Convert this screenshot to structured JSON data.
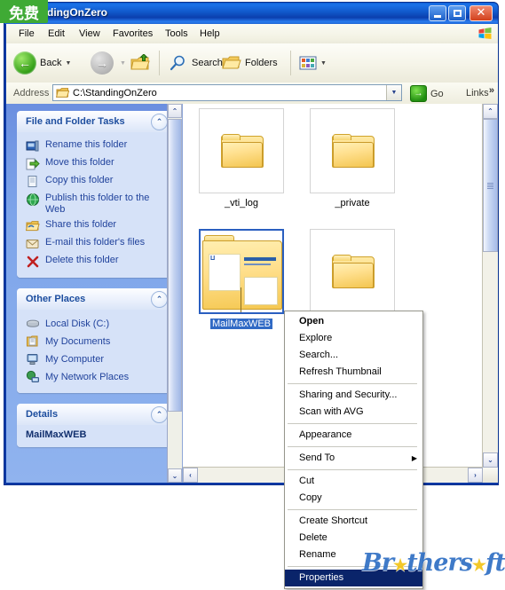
{
  "window": {
    "title": "StandingOnZero",
    "badge": "免费",
    "controls": {
      "minimize": "Minimize",
      "maximize": "Maximize",
      "close": "Close"
    }
  },
  "menubar": {
    "items": [
      {
        "label": "File"
      },
      {
        "label": "Edit"
      },
      {
        "label": "View"
      },
      {
        "label": "Favorites"
      },
      {
        "label": "Tools"
      },
      {
        "label": "Help"
      }
    ],
    "logo": "windows-flag-icon"
  },
  "toolbar": {
    "back": "Back",
    "forward": "Forward",
    "up": "Up",
    "search": "Search",
    "folders": "Folders",
    "views": "Views"
  },
  "address": {
    "label": "Address",
    "value": "C:\\StandingOnZero",
    "go": "Go",
    "links": "Links",
    "chevron": "»"
  },
  "sidebar": {
    "panels": [
      {
        "title": "File and Folder Tasks",
        "collapse": "collapse-chevron-icon",
        "items": [
          {
            "label": "Rename this folder",
            "icon": "rename-icon"
          },
          {
            "label": "Move this folder",
            "icon": "move-icon"
          },
          {
            "label": "Copy this folder",
            "icon": "copy-icon"
          },
          {
            "label": "Publish this folder to the Web",
            "icon": "publish-web-icon"
          },
          {
            "label": "Share this folder",
            "icon": "share-folder-icon"
          },
          {
            "label": "E-mail this folder's files",
            "icon": "email-icon"
          },
          {
            "label": "Delete this folder",
            "icon": "delete-x-icon"
          }
        ]
      },
      {
        "title": "Other Places",
        "collapse": "collapse-chevron-icon",
        "items": [
          {
            "label": "Local Disk (C:)",
            "icon": "hard-disk-icon"
          },
          {
            "label": "My Documents",
            "icon": "my-documents-icon"
          },
          {
            "label": "My Computer",
            "icon": "my-computer-icon"
          },
          {
            "label": "My Network Places",
            "icon": "network-places-icon"
          }
        ]
      },
      {
        "title": "Details",
        "collapse": "collapse-chevron-icon",
        "selected_name": "MailMaxWEB"
      }
    ]
  },
  "files": {
    "view": "thumbnails",
    "items": [
      {
        "name": "_vti_log",
        "type": "folder",
        "selected": false
      },
      {
        "name": "_private",
        "type": "folder",
        "selected": false
      },
      {
        "name": "MailMaxWEB",
        "type": "folder-thumbnail",
        "selected": true
      },
      {
        "name": "",
        "type": "folder",
        "selected": false
      }
    ]
  },
  "context_menu": {
    "groups": [
      [
        {
          "label": "Open",
          "bold": true,
          "highlighted": false,
          "submenu": false
        },
        {
          "label": "Explore",
          "bold": false,
          "highlighted": false,
          "submenu": false
        },
        {
          "label": "Search...",
          "bold": false,
          "highlighted": false,
          "submenu": false
        },
        {
          "label": "Refresh Thumbnail",
          "bold": false,
          "highlighted": false,
          "submenu": false
        }
      ],
      [
        {
          "label": "Sharing and Security...",
          "bold": false,
          "highlighted": false,
          "submenu": false
        },
        {
          "label": "Scan with AVG",
          "bold": false,
          "highlighted": false,
          "submenu": false
        }
      ],
      [
        {
          "label": "Appearance",
          "bold": false,
          "highlighted": false,
          "submenu": false
        }
      ],
      [
        {
          "label": "Send To",
          "bold": false,
          "highlighted": false,
          "submenu": true
        }
      ],
      [
        {
          "label": "Cut",
          "bold": false,
          "highlighted": false,
          "submenu": false
        },
        {
          "label": "Copy",
          "bold": false,
          "highlighted": false,
          "submenu": false
        }
      ],
      [
        {
          "label": "Create Shortcut",
          "bold": false,
          "highlighted": false,
          "submenu": false
        },
        {
          "label": "Delete",
          "bold": false,
          "highlighted": false,
          "submenu": false
        },
        {
          "label": "Rename",
          "bold": false,
          "highlighted": false,
          "submenu": false
        }
      ],
      [
        {
          "label": "Properties",
          "bold": false,
          "highlighted": true,
          "submenu": false
        }
      ]
    ]
  },
  "watermark": {
    "part1": "Br",
    "star": "★",
    "part2": "thers",
    "star2": "★",
    "part3": "ft"
  },
  "colors": {
    "titlebar_blue": "#1157c9",
    "badge_green": "#3faa35",
    "selection_blue": "#316ac5",
    "menu_highlight": "#0a246a",
    "task_link": "#21439c",
    "panel_bg": "#d6e2f8"
  }
}
